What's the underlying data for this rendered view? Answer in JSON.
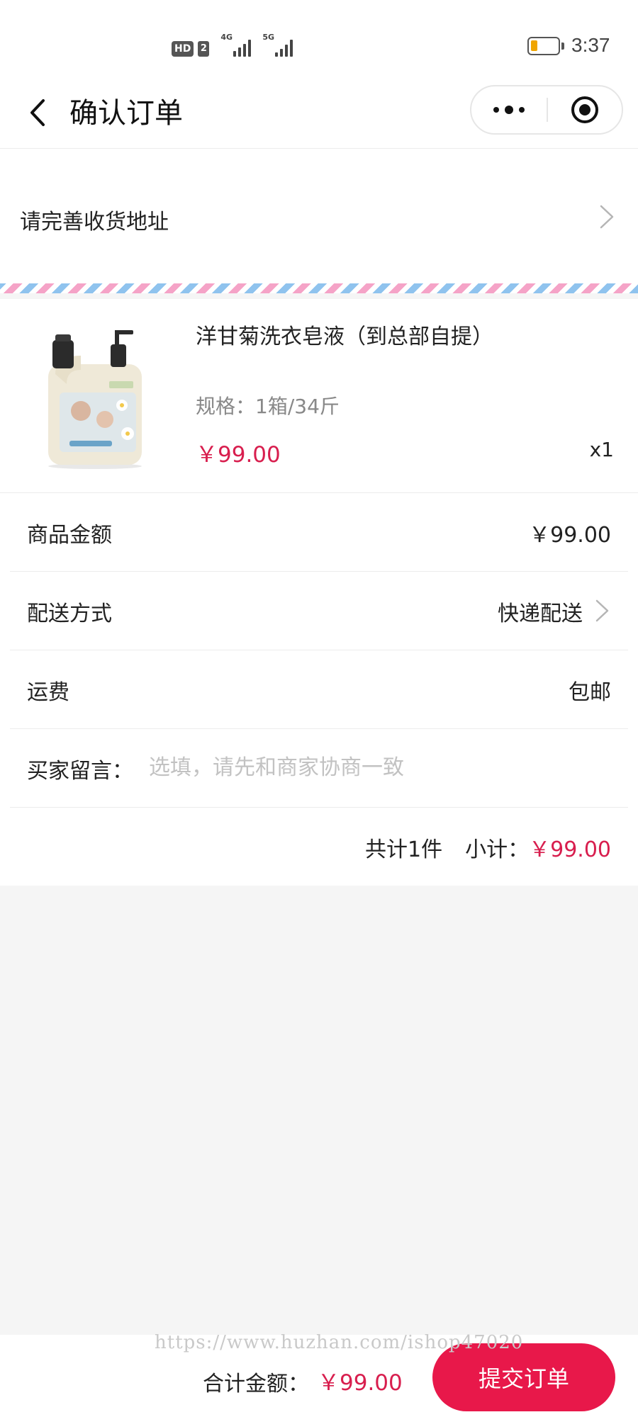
{
  "status_bar": {
    "hd_label": "HD",
    "sim_label": "2",
    "network_1": "4G",
    "network_2": "5G",
    "battery_level": 0.15,
    "time": "3:37"
  },
  "header": {
    "title": "确认订单",
    "back_icon": "chevron-left-icon",
    "more_icon": "more-dots-icon",
    "close_icon": "target-circle-icon"
  },
  "address": {
    "prompt": "请完善收货地址"
  },
  "product": {
    "name": "洋甘菊洗衣皂液（到总部自提）",
    "spec": "规格：1箱/34斤",
    "price": "￥99.00",
    "quantity": "x1",
    "image_icon": "laundry-detergent-bottle-image"
  },
  "rows": {
    "goods_amount_label": "商品金额",
    "goods_amount_value": "￥99.00",
    "delivery_label": "配送方式",
    "delivery_value": "快递配送",
    "shipping_label": "运费",
    "shipping_value": "包邮",
    "message_label": "买家留言：",
    "message_placeholder": "选填，请先和商家协商一致",
    "message_value": ""
  },
  "summary": {
    "count_text": "共计1件",
    "subtotal_label": "小计：",
    "subtotal_value": "￥99.00"
  },
  "footer": {
    "watermark": "https://www.huzhan.com/ishop47020",
    "total_label": "合计金额：",
    "total_value": "￥99.00",
    "submit_label": "提交订单"
  },
  "colors": {
    "accent": "#e8184a",
    "price": "#d81e4e",
    "background": "#f5f5f5"
  }
}
